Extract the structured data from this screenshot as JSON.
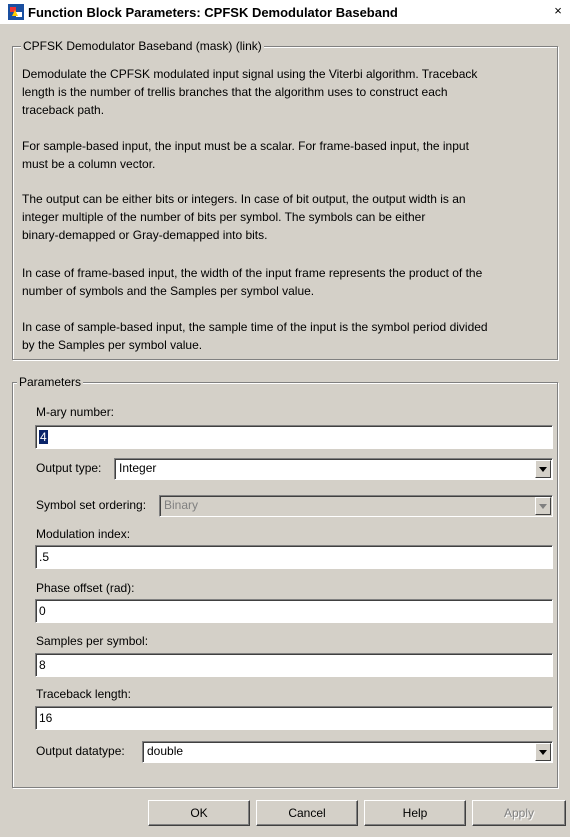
{
  "window": {
    "title": "Function Block Parameters: CPFSK Demodulator Baseband",
    "close_glyph": "×"
  },
  "description": {
    "legend": "CPFSK Demodulator Baseband (mask) (link)",
    "paragraphs": [
      [
        "Demodulate the CPFSK modulated input signal using the Viterbi algorithm. Traceback",
        "length is the number of trellis branches that the algorithm uses to construct each",
        "traceback path."
      ],
      [
        "For sample-based input, the input must be a scalar. For frame-based input, the input",
        "must be a column vector."
      ],
      [
        "The output can be either bits or integers. In case of bit output, the output width is an",
        "integer multiple of the number of bits per symbol. The symbols can be either",
        "binary-demapped or Gray-demapped into bits."
      ],
      [
        "In case of frame-based input, the width of the input frame represents the product of the",
        "number of symbols and the Samples per symbol value."
      ],
      [
        "In case of sample-based input, the sample time of the input is the symbol period divided",
        "by the Samples per symbol value."
      ]
    ]
  },
  "parameters": {
    "legend": "Parameters",
    "mary_label": "M-ary number:",
    "mary_value": "4",
    "output_type_label": "Output type:",
    "output_type_value": "Integer",
    "symbol_ordering_label": "Symbol set ordering:",
    "symbol_ordering_value": "Binary",
    "mod_index_label": "Modulation index:",
    "mod_index_value": ".5",
    "phase_offset_label": "Phase offset (rad):",
    "phase_offset_value": "0",
    "samples_label": "Samples per symbol:",
    "samples_value": "8",
    "traceback_label": "Traceback length:",
    "traceback_value": "16",
    "datatype_label": "Output datatype:",
    "datatype_value": "double"
  },
  "buttons": {
    "ok": "OK",
    "cancel": "Cancel",
    "help": "Help",
    "apply": "Apply"
  },
  "icons": {
    "app": "simulink-block-icon",
    "close": "close-icon",
    "dropdown": "dropdown-arrow-icon"
  }
}
